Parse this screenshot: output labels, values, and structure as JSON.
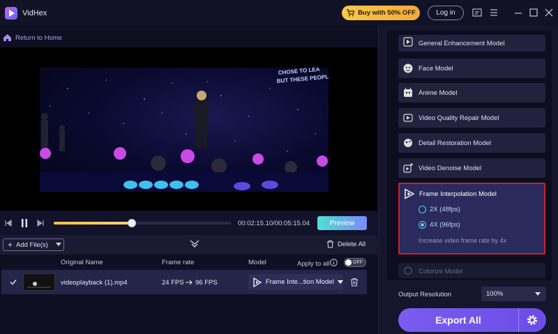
{
  "app": {
    "name": "VidHex"
  },
  "header": {
    "buy_label": "Buy with 50% OFF",
    "login_label": "Log in"
  },
  "nav": {
    "return_label": "Return to Home"
  },
  "player": {
    "time": "00:02:15.10/00:05:15.04",
    "preview_label": "Preview",
    "progress": 0.44
  },
  "video_text": {
    "line1": "CHOSE TO LEA",
    "line2": "BUT THESE PEOPLE S"
  },
  "files": {
    "add_label": "Add File(s)",
    "delete_all_label": "Delete All",
    "columns": {
      "name": "Original Name",
      "frame_rate": "Frame rate",
      "model": "Model",
      "apply_all": "Apply to all"
    },
    "toggle_label": "OFF",
    "row": {
      "name": "videoplayback (1).mp4",
      "fps_from": "24 FPS",
      "fps_to": "96 FPS",
      "model": "Frame Inte...tion Model"
    }
  },
  "models": {
    "general": "General Enhancement Model",
    "face": "Face Model",
    "anime": "Anime Model",
    "quality_repair": "Video Quality Repair Model",
    "detail": "Detail Restoration Model",
    "denoise": "Video Denoise Model",
    "interpolation": {
      "title": "Frame Interpolation Model",
      "options": [
        "2X (48fps)",
        "4X (96fps)"
      ],
      "desc": "Increase video frame rate by 4x"
    },
    "colorize": "Colorize Model"
  },
  "output": {
    "label": "Output Resolution",
    "value": "100%"
  },
  "export_label": "Export All",
  "colors": {
    "accent": "#7a5cf0",
    "highlight_border": "#c8232f",
    "gold": "#f3c14a"
  }
}
